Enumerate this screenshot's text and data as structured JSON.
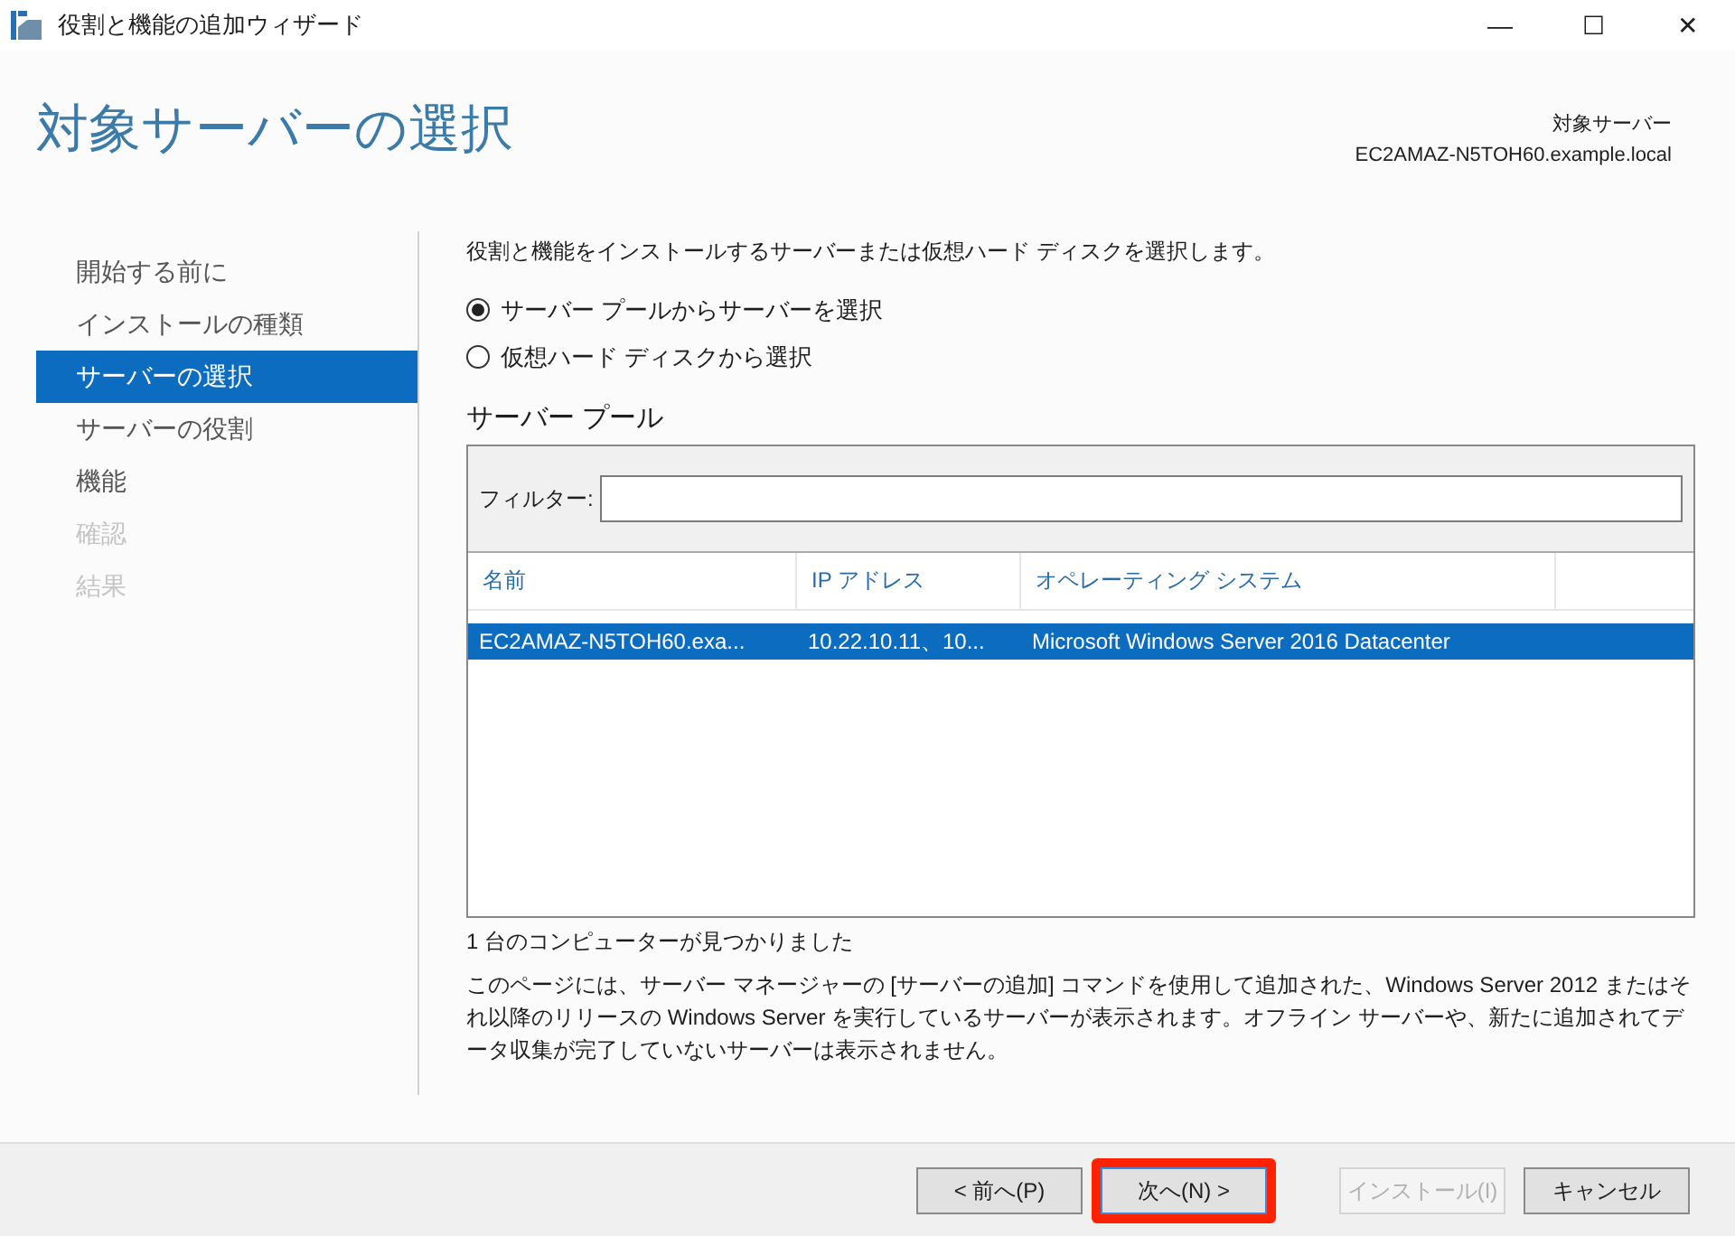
{
  "window": {
    "title": "役割と機能の追加ウィザード",
    "controls": [
      "—",
      "☐",
      "✕"
    ]
  },
  "header": {
    "title": "対象サーバーの選択",
    "target_label": "対象サーバー",
    "target_server": "EC2AMAZ-N5TOH60.example.local"
  },
  "sidebar": {
    "items": [
      {
        "label": "開始する前に",
        "selected": false,
        "disabled": false
      },
      {
        "label": "インストールの種類",
        "selected": false,
        "disabled": false
      },
      {
        "label": "サーバーの選択",
        "selected": true,
        "disabled": false
      },
      {
        "label": "サーバーの役割",
        "selected": false,
        "disabled": false
      },
      {
        "label": "機能",
        "selected": false,
        "disabled": false
      },
      {
        "label": "確認",
        "selected": false,
        "disabled": true
      },
      {
        "label": "結果",
        "selected": false,
        "disabled": true
      }
    ]
  },
  "intro": "役割と機能をインストールするサーバーまたは仮想ハード ディスクを選択します。",
  "options": [
    {
      "label": "サーバー プールからサーバーを選択",
      "selected": true
    },
    {
      "label": "仮想ハード ディスクから選択",
      "selected": false
    }
  ],
  "pool": {
    "title": "サーバー プール",
    "filter_label": "フィルター:",
    "columns": [
      "名前",
      "IP アドレス",
      "オペレーティング システム"
    ],
    "rows": [
      {
        "cells": [
          "EC2AMAZ-N5TOH60.exa...",
          "10.22.10.11、10...",
          "Microsoft Windows Server 2016 Datacenter"
        ],
        "selected": true
      }
    ]
  },
  "count": "1 台のコンピューターが見つかりました",
  "description": "このページには、サーバー マネージャーの [サーバーの追加] コマンドを使用して追加された、Windows Server 2012 またはそれ以降のリリースの Windows Server を実行しているサーバーが表示されます。オフライン サーバーや、新たに追加されてデータ収集が完了していないサーバーは表示されません。",
  "buttons": [
    {
      "label": "< 前へ(P)",
      "disabled": false,
      "highlighted": false
    },
    {
      "label": "次へ(N) >",
      "disabled": false,
      "highlighted": true
    },
    {
      "label": "インストール(I)",
      "disabled": true,
      "highlighted": false
    },
    {
      "label": "キャンセル",
      "disabled": false,
      "highlighted": false
    }
  ]
}
